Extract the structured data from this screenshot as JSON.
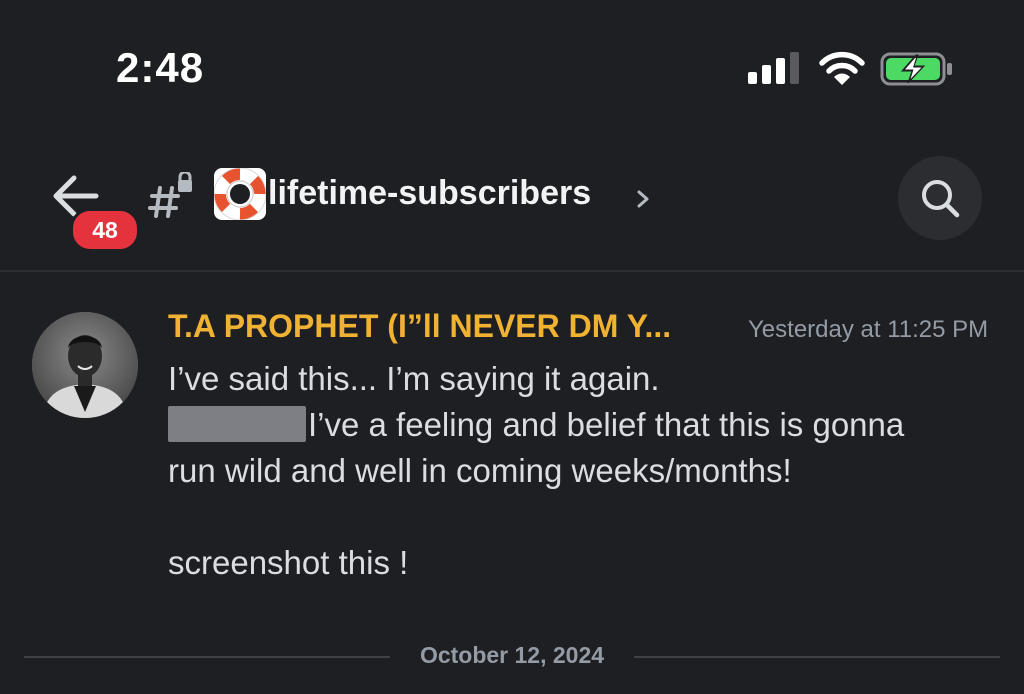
{
  "status_bar": {
    "time": "2:48",
    "icons": [
      "cellular-signal-icon",
      "wifi-icon",
      "battery-charging-icon"
    ]
  },
  "header": {
    "back_icon": "arrow-left-icon",
    "unread_count": "48",
    "channel_type_icon": "locked-hash-icon",
    "channel_emoji": "lifebuoy-icon",
    "channel_name": "lifetime-subscribers",
    "chevron_icon": "chevron-right-icon",
    "search_icon": "search-icon"
  },
  "message": {
    "author": "T.A PROPHET (I”ll NEVER DM Y...",
    "timestamp": "Yesterday at 11:25 PM",
    "lines": [
      "I’ve said this... I’m saying it again.",
      "I’ve a feeling and belief that this is gonna",
      "run wild and well in coming weeks/months!",
      "screenshot this !"
    ]
  },
  "date_divider": {
    "label": "October 12, 2024"
  },
  "colors": {
    "background": "#1e1f22",
    "author": "#f0b232",
    "badge": "#e5333d",
    "battery": "#4cd964",
    "muted": "#949ba4"
  }
}
